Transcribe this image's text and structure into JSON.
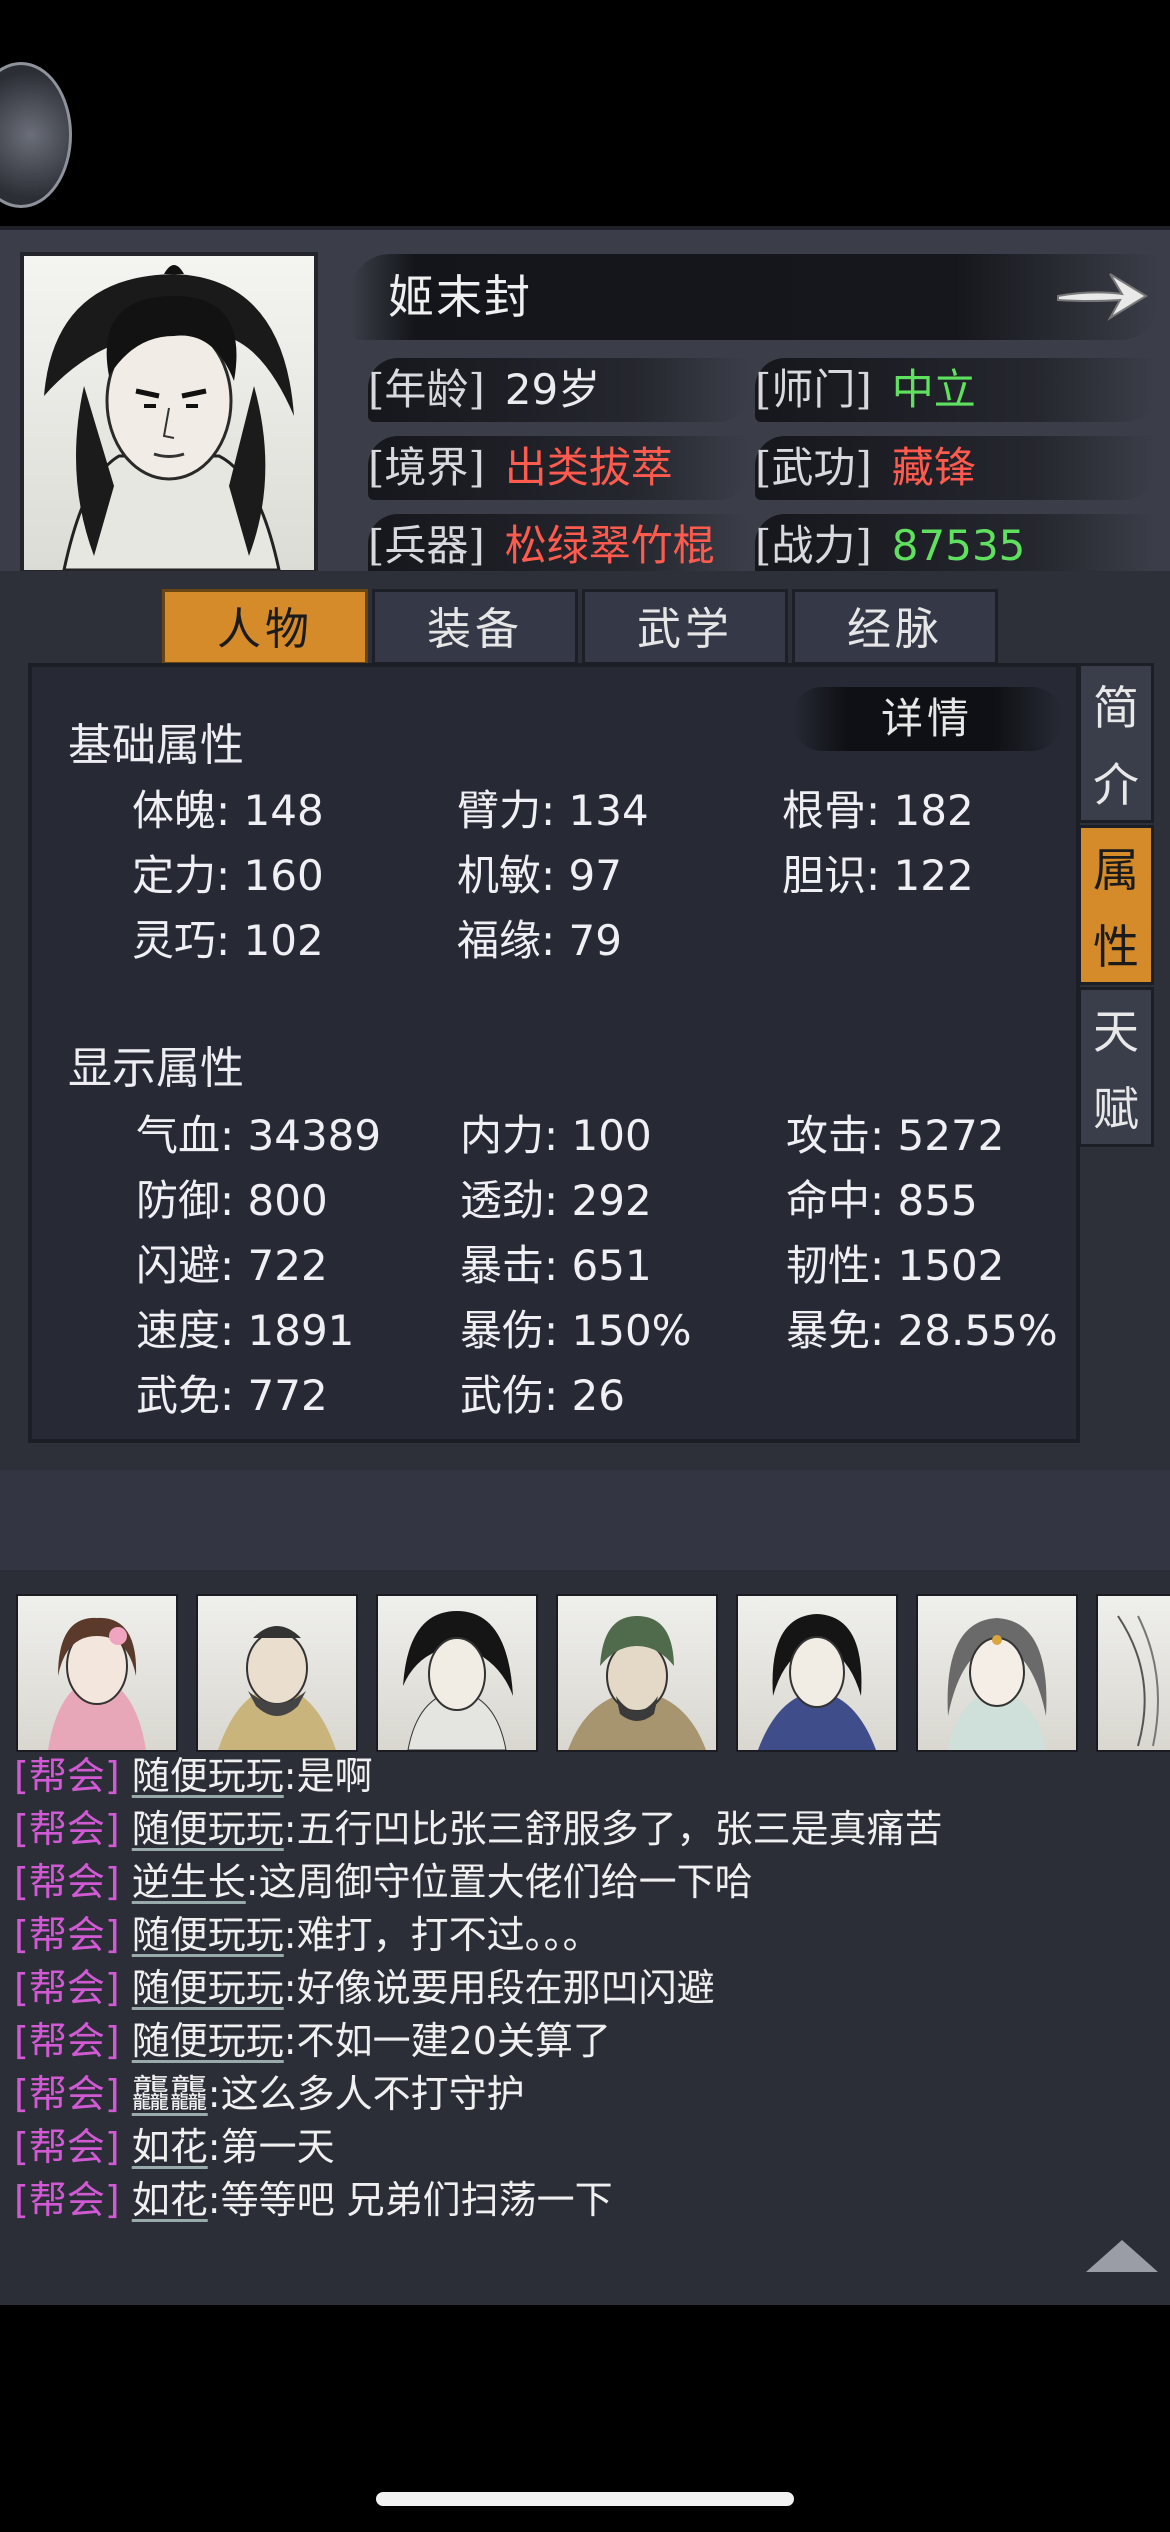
{
  "header": {
    "name": "姬末封",
    "rows": [
      {
        "left_label": "[年龄]",
        "left_value": "29岁",
        "right_label": "[师门]",
        "right_value": "中立"
      },
      {
        "left_label": "[境界]",
        "left_value": "出类拔萃",
        "right_label": "[武功]",
        "right_value": "藏锋"
      },
      {
        "left_label": "[兵器]",
        "left_value": "松绿翠竹棍",
        "right_label": "[战力]",
        "right_value": "87535"
      }
    ]
  },
  "tabs": [
    "人物",
    "装备",
    "武学",
    "经脉"
  ],
  "side_tabs": [
    {
      "chars": [
        "简",
        "介"
      ]
    },
    {
      "chars": [
        "属",
        "性"
      ]
    },
    {
      "chars": [
        "天",
        "赋"
      ]
    }
  ],
  "basic": {
    "title": "基础属性",
    "detail": "详情",
    "stats": [
      "体魄: 148",
      "臂力: 134",
      "根骨: 182",
      "定力: 160",
      "机敏: 97",
      "胆识: 122",
      "灵巧: 102",
      "福缘: 79"
    ]
  },
  "display": {
    "title": "显示属性",
    "stats": [
      "气血: 34389",
      "内力: 100",
      "攻击: 5272",
      "防御: 800",
      "透劲: 292",
      "命中: 855",
      "闪避: 722",
      "暴击: 651",
      "韧性: 1502",
      "速度: 1891",
      "暴伤: 150%",
      "暴免: 28.55%",
      "武免: 772",
      "武伤: 26"
    ]
  },
  "chat": [
    {
      "channel": "[帮会]",
      "user": "随便玩玩",
      "msg": ":是啊"
    },
    {
      "channel": "[帮会]",
      "user": "随便玩玩",
      "msg": ":五行凹比张三舒服多了，张三是真痛苦"
    },
    {
      "channel": "[帮会]",
      "user": "逆生长",
      "msg": ":这周御守位置大佬们给一下哈"
    },
    {
      "channel": "[帮会]",
      "user": "随便玩玩",
      "msg": ":难打，打不过。。。"
    },
    {
      "channel": "[帮会]",
      "user": "随便玩玩",
      "msg": ":好像说要用段在那凹闪避"
    },
    {
      "channel": "[帮会]",
      "user": "随便玩玩",
      "msg": ":不如一建20关算了"
    },
    {
      "channel": "[帮会]",
      "user": "龘龘",
      "msg": ":这么多人不打守护"
    },
    {
      "channel": "[帮会]",
      "user": "如花",
      "msg": ":第一天"
    },
    {
      "channel": "[帮会]",
      "user": "如花",
      "msg": ":等等吧 兄弟们扫荡一下"
    }
  ],
  "colors": {
    "accent": "#d58b2a",
    "green": "#5fe15f",
    "red": "#ff5a4e",
    "channel": "#d15ad4"
  }
}
